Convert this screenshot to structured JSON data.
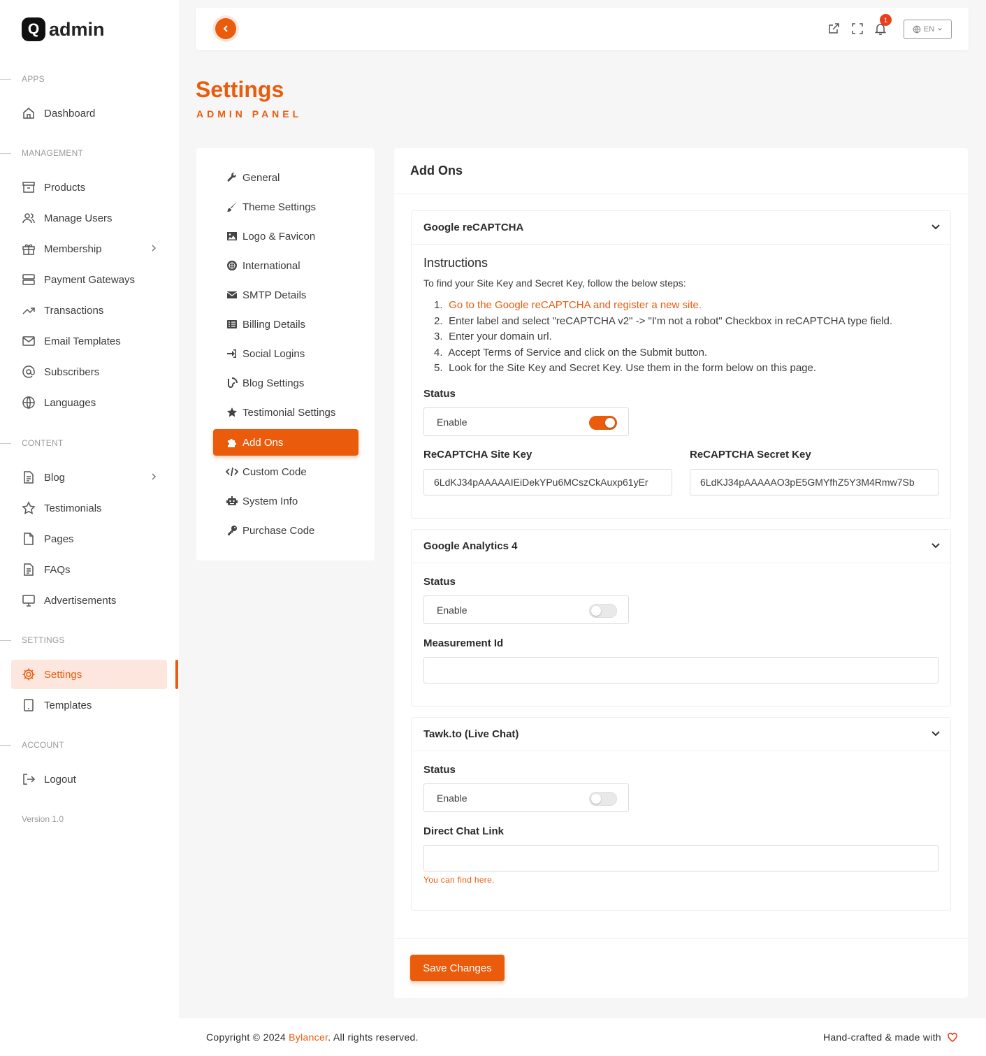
{
  "brand": {
    "mark": "Q",
    "name": "admin"
  },
  "sidebar": {
    "sections": {
      "apps": "APPS",
      "management": "MANAGEMENT",
      "content": "CONTENT",
      "settings": "SETTINGS",
      "account": "ACCOUNT"
    },
    "items": {
      "dashboard": "Dashboard",
      "products": "Products",
      "manage_users": "Manage Users",
      "membership": "Membership",
      "payment_gateways": "Payment Gateways",
      "transactions": "Transactions",
      "email_templates": "Email Templates",
      "subscribers": "Subscribers",
      "languages": "Languages",
      "blog": "Blog",
      "testimonials": "Testimonials",
      "pages": "Pages",
      "faqs": "FAQs",
      "advertisements": "Advertisements",
      "settings": "Settings",
      "templates": "Templates",
      "logout": "Logout"
    },
    "version": "Version 1.0"
  },
  "topbar": {
    "notification_count": "1",
    "language": "EN"
  },
  "page": {
    "title": "Settings",
    "subtitle": "ADMIN PANEL"
  },
  "settings_menu": [
    {
      "label": "General",
      "icon": "wrench-icon"
    },
    {
      "label": "Theme Settings",
      "icon": "brush-icon"
    },
    {
      "label": "Logo & Favicon",
      "icon": "image-icon"
    },
    {
      "label": "International",
      "icon": "globe-icon"
    },
    {
      "label": "SMTP Details",
      "icon": "envelope-icon"
    },
    {
      "label": "Billing Details",
      "icon": "list-icon"
    },
    {
      "label": "Social Logins",
      "icon": "sign-in-icon"
    },
    {
      "label": "Blog Settings",
      "icon": "blog-icon"
    },
    {
      "label": "Testimonial Settings",
      "icon": "star-icon"
    },
    {
      "label": "Add Ons",
      "icon": "puzzle-icon"
    },
    {
      "label": "Custom Code",
      "icon": "code-icon"
    },
    {
      "label": "System Info",
      "icon": "robot-icon"
    },
    {
      "label": "Purchase Code",
      "icon": "key-icon"
    }
  ],
  "panel": {
    "title": "Add Ons",
    "recaptcha": {
      "title": "Google reCAPTCHA",
      "instructions_title": "Instructions",
      "instructions_intro": "To find your Site Key and Secret Key, follow the below steps:",
      "steps": [
        {
          "num": "1.",
          "text": "Go to the Google reCAPTCHA and register a new site."
        },
        {
          "num": "2.",
          "text": "Enter label and select \"reCAPTCHA v2\" -> \"I'm not a robot\" Checkbox in reCAPTCHA type field."
        },
        {
          "num": "3.",
          "text": "Enter your domain url."
        },
        {
          "num": "4.",
          "text": "Accept Terms of Service and click on the Submit button."
        },
        {
          "num": "5.",
          "text": "Look for the Site Key and Secret Key. Use them in the form below on this page."
        }
      ],
      "status_label": "Status",
      "toggle_label": "Enable",
      "enabled": true,
      "site_key_label": "ReCAPTCHA Site Key",
      "site_key_value": "6LdKJ34pAAAAAIEiDekYPu6MCszCkAuxp61yEr",
      "secret_key_label": "ReCAPTCHA Secret Key",
      "secret_key_value": "6LdKJ34pAAAAAO3pE5GMYfhZ5Y3M4Rmw7Sb"
    },
    "analytics": {
      "title": "Google Analytics 4",
      "status_label": "Status",
      "toggle_label": "Enable",
      "enabled": false,
      "measurement_label": "Measurement Id",
      "measurement_value": ""
    },
    "tawk": {
      "title": "Tawk.to (Live Chat)",
      "status_label": "Status",
      "toggle_label": "Enable",
      "enabled": false,
      "link_label": "Direct Chat Link",
      "link_value": "",
      "help": "You can find here."
    },
    "save_label": "Save Changes"
  },
  "footer": {
    "copyright_prefix": "Copyright © 2024 ",
    "company": "Bylancer",
    "copyright_suffix": ". All rights reserved.",
    "made_with": "Hand-crafted & made with"
  },
  "colors": {
    "accent": "#ea5b0c",
    "accent_light": "#fde6dd"
  }
}
